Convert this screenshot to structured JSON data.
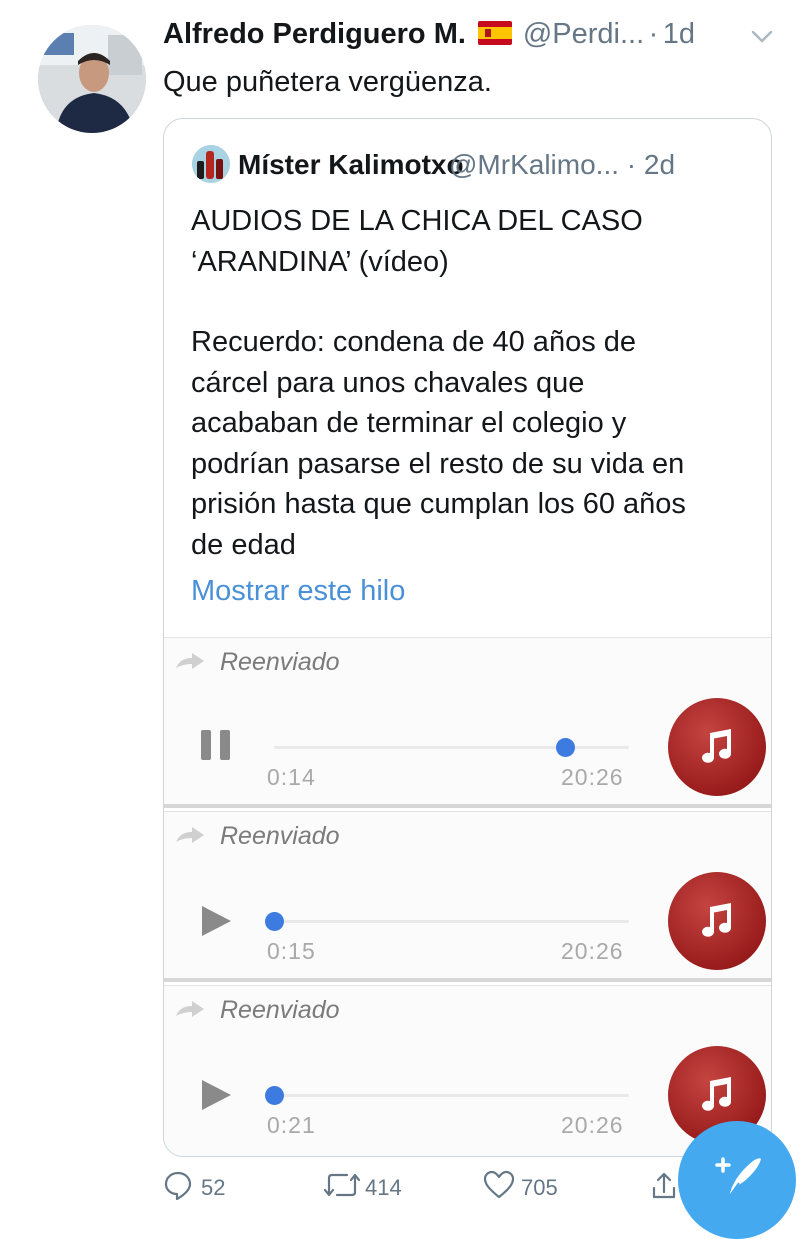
{
  "tweet": {
    "author_name": "Alfredo Perdiguero M.",
    "author_flag_icon": "spain-flag-icon",
    "author_handle": "@Perdi...",
    "separator": "·",
    "time": "1d",
    "text": "Que puñetera vergüenza."
  },
  "quoted": {
    "author_name": "Míster Kalimotxo",
    "author_handle": "@MrKalimo...",
    "separator": "·",
    "time": "2d",
    "line1": "AUDIOS DE LA CHICA DEL CASO",
    "line2": "‘ARANDINA’ (vídeo)",
    "para2": [
      "Recuerdo: condena de 40 años de",
      "cárcel para unos chavales que",
      "acababan de terminar el colegio y",
      "podrían pasarse el resto de su vida en",
      "prisión hasta que cumplan los 60 años",
      "de edad"
    ],
    "show_thread": "Mostrar este hilo"
  },
  "audios": [
    {
      "forward_label": "Reenviado",
      "state": "playing",
      "control_icon": "pause-icon",
      "current_time": "0:14",
      "total_time": "20:26",
      "progress": 0.82
    },
    {
      "forward_label": "Reenviado",
      "state": "paused",
      "control_icon": "play-icon",
      "current_time": "0:15",
      "total_time": "20:26",
      "progress": 0.0
    },
    {
      "forward_label": "Reenviado",
      "state": "paused",
      "control_icon": "play-icon",
      "current_time": "0:21",
      "total_time": "20:26",
      "progress": 0.0
    }
  ],
  "actions": {
    "replies": "52",
    "retweets": "414",
    "likes": "705"
  },
  "colors": {
    "link": "#4a90d8",
    "audio_knob": "#3d7be0",
    "music_button": "#9a1d1d",
    "compose_button": "#45a9f0"
  }
}
